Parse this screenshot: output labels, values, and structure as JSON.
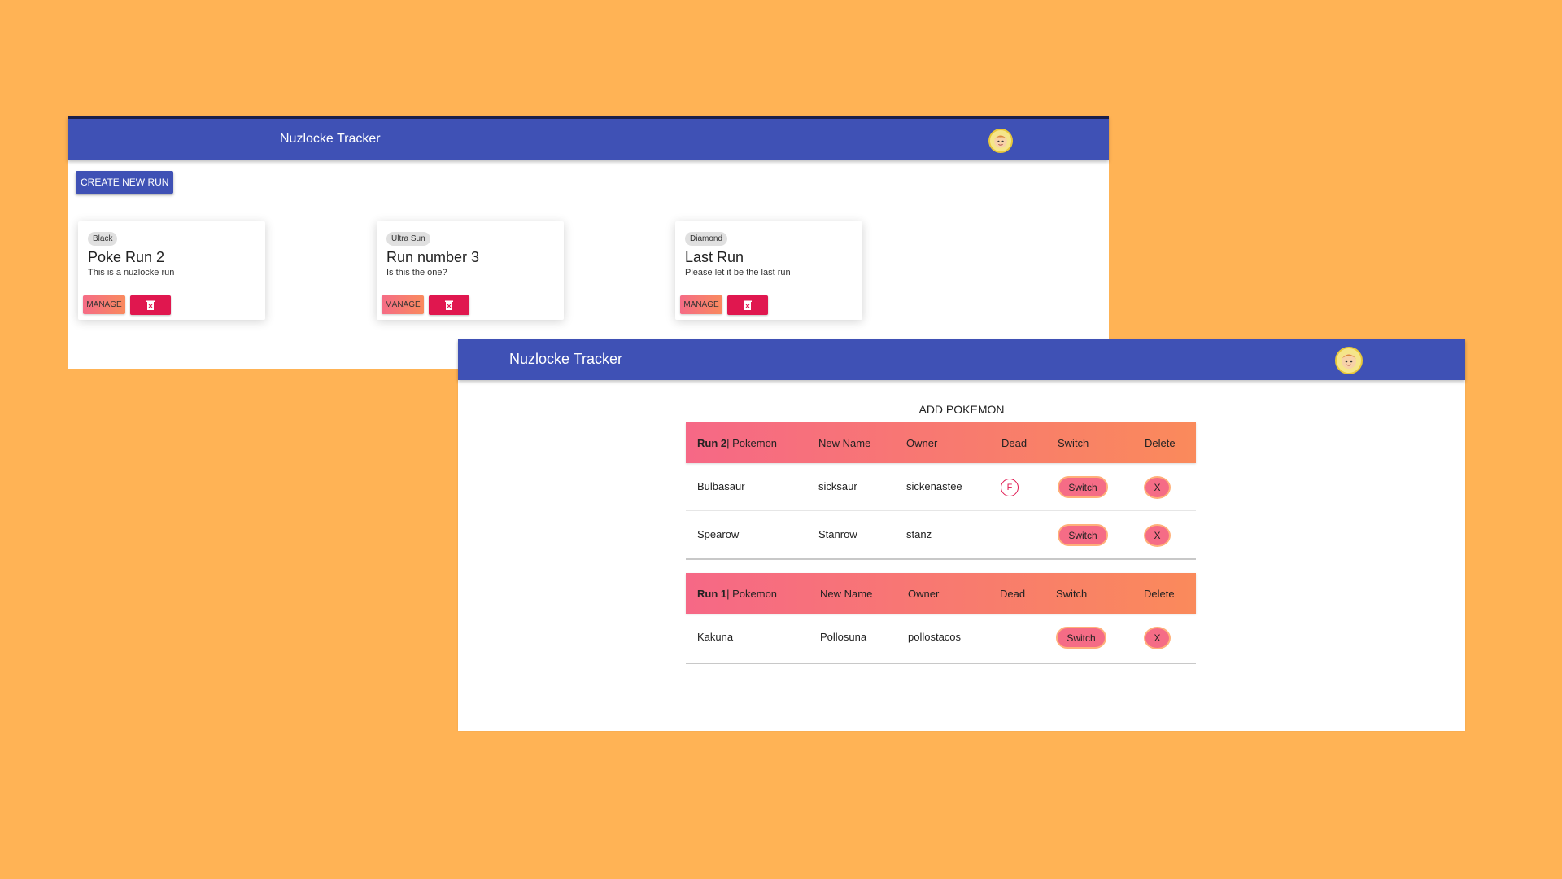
{
  "colors": {
    "background": "#FFB355",
    "appbar": "#3F51B5",
    "accent": "#E0174F",
    "gradient_start": "#F66886",
    "gradient_end": "#FA8A5B"
  },
  "runs_window": {
    "app_title": "Nuzlocke Tracker",
    "avatar_icon": "avatar-icon",
    "create_button": "CREATE NEW RUN",
    "cards": [
      {
        "game": "Black",
        "title": "Poke Run 2",
        "description": "This is a nuzlocke run",
        "manage_label": "MANAGE",
        "delete_icon": "trash-icon"
      },
      {
        "game": "Ultra Sun",
        "title": "Run number 3",
        "description": "Is this the one?",
        "manage_label": "MANAGE",
        "delete_icon": "trash-icon"
      },
      {
        "game": "Diamond",
        "title": "Last Run",
        "description": "Please let it be the last run",
        "manage_label": "MANAGE",
        "delete_icon": "trash-icon"
      }
    ]
  },
  "pokemon_window": {
    "app_title": "Nuzlocke Tracker",
    "avatar_icon": "avatar-icon",
    "add_pokemon": "ADD POKEMON",
    "tables": [
      {
        "run_label": "Run 2",
        "headers": [
          "| Pokemon",
          "New Name",
          "Owner",
          "Dead",
          "Switch",
          "Delete"
        ],
        "rows": [
          {
            "pokemon": "Bulbasaur",
            "new_name": "sicksaur",
            "owner": "sickenastee",
            "dead": "F",
            "switch": "Switch",
            "delete": "X"
          },
          {
            "pokemon": "Spearow",
            "new_name": "Stanrow",
            "owner": "stanz",
            "dead": "",
            "switch": "Switch",
            "delete": "X"
          }
        ]
      },
      {
        "run_label": "Run 1",
        "headers": [
          "| Pokemon",
          "New Name",
          "Owner",
          "Dead",
          "Switch",
          "Delete"
        ],
        "rows": [
          {
            "pokemon": "Kakuna",
            "new_name": "Pollosuna",
            "owner": "pollostacos",
            "dead": "",
            "switch": "Switch",
            "delete": "X"
          }
        ]
      }
    ]
  }
}
